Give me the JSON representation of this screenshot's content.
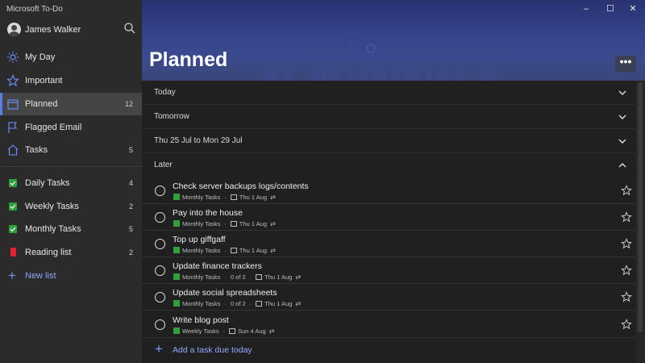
{
  "app": {
    "title": "Microsoft To-Do"
  },
  "user": {
    "name": "James Walker"
  },
  "sidebar": {
    "items": [
      {
        "label": "My Day",
        "count": "",
        "icon": "sun-icon"
      },
      {
        "label": "Important",
        "count": "",
        "icon": "star-icon"
      },
      {
        "label": "Planned",
        "count": "12",
        "icon": "calendar-icon"
      },
      {
        "label": "Flagged Email",
        "count": "",
        "icon": "flag-icon"
      },
      {
        "label": "Tasks",
        "count": "5",
        "icon": "home-icon"
      }
    ],
    "lists": [
      {
        "label": "Daily Tasks",
        "count": "4",
        "icon": "checkbox-icon"
      },
      {
        "label": "Weekly Tasks",
        "count": "2",
        "icon": "checkbox-icon"
      },
      {
        "label": "Monthly Tasks",
        "count": "5",
        "icon": "checkbox-icon"
      },
      {
        "label": "Reading list",
        "count": "2",
        "icon": "book-icon"
      }
    ],
    "new_list": "New list"
  },
  "main": {
    "title": "Planned",
    "more_label": "•••",
    "sections": [
      {
        "label": "Today",
        "expanded": false
      },
      {
        "label": "Tomorrow",
        "expanded": false
      },
      {
        "label": "Thu 25 Jul to Mon 29 Jul",
        "expanded": false
      },
      {
        "label": "Later",
        "expanded": true
      }
    ],
    "tasks": [
      {
        "title": "Check server backups logs/contents",
        "list": "Monthly Tasks",
        "steps": "",
        "due": "Thu 1 Aug"
      },
      {
        "title": "Pay into the house",
        "list": "Monthly Tasks",
        "steps": "",
        "due": "Thu 1 Aug"
      },
      {
        "title": "Top up giffgaff",
        "list": "Monthly Tasks",
        "steps": "",
        "due": "Thu 1 Aug"
      },
      {
        "title": "Update finance trackers",
        "list": "Monthly Tasks",
        "steps": "0 of 2",
        "due": "Thu 1 Aug"
      },
      {
        "title": "Update social spreadsheets",
        "list": "Monthly Tasks",
        "steps": "0 of 2",
        "due": "Thu 1 Aug"
      },
      {
        "title": "Write blog post",
        "list": "Weekly Tasks",
        "steps": "",
        "due": "Sun 4 Aug"
      }
    ],
    "add_task": "Add a task due today"
  },
  "colors": {
    "accent": "#5a7ee8",
    "list_green": "#2fa13b",
    "reading_red": "#e0242f"
  }
}
